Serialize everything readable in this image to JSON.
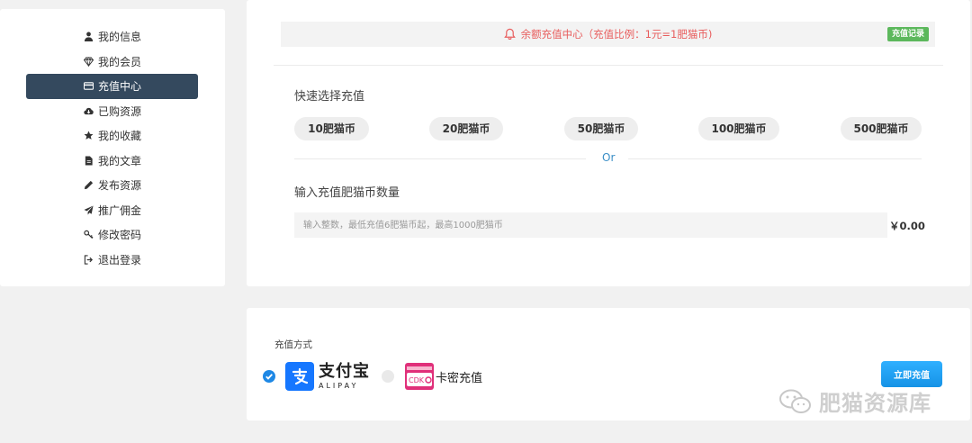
{
  "sidebar": {
    "items": [
      {
        "label": "我的信息",
        "icon": "user-icon",
        "active": false
      },
      {
        "label": "我的会员",
        "icon": "diamond-icon",
        "active": false
      },
      {
        "label": "充值中心",
        "icon": "credit-card-icon",
        "active": true
      },
      {
        "label": "已购资源",
        "icon": "cloud-download-icon",
        "active": false
      },
      {
        "label": "我的收藏",
        "icon": "star-icon",
        "active": false
      },
      {
        "label": "我的文章",
        "icon": "file-icon",
        "active": false
      },
      {
        "label": "发布资源",
        "icon": "pencil-icon",
        "active": false
      },
      {
        "label": "推广佣金",
        "icon": "paper-plane-icon",
        "active": false
      },
      {
        "label": "修改密码",
        "icon": "key-icon",
        "active": false
      },
      {
        "label": "退出登录",
        "icon": "sign-out-icon",
        "active": false
      }
    ],
    "active_color": "#34495e"
  },
  "notice": {
    "text": "余额充值中心（充值比例：1元=1肥猫币)",
    "icon": "bell-icon",
    "color": "#e85d5d",
    "record_button": "充值记录"
  },
  "quick": {
    "title": "快速选择充值",
    "amounts": [
      "10肥猫币",
      "20肥猫币",
      "50肥猫币",
      "100肥猫币",
      "500肥猫币"
    ]
  },
  "or_text": "Or",
  "custom": {
    "title": "输入充值肥猫币数量",
    "placeholder": "输入整数，最低充值6肥猫币起，最高1000肥猫币",
    "value": "",
    "price": "￥0.00"
  },
  "payment": {
    "title": "充值方式",
    "methods": [
      {
        "name": "支付宝",
        "sub": "ALIPAY",
        "icon": "alipay-icon",
        "selected": true
      },
      {
        "name": "卡密充值",
        "logo_text": "CDK",
        "icon": "cdk-icon",
        "selected": false
      }
    ],
    "submit": "立即充值",
    "button_color": "#1da1f2"
  },
  "watermark": {
    "text": "肥猫资源库",
    "icon": "wechat-icon"
  }
}
